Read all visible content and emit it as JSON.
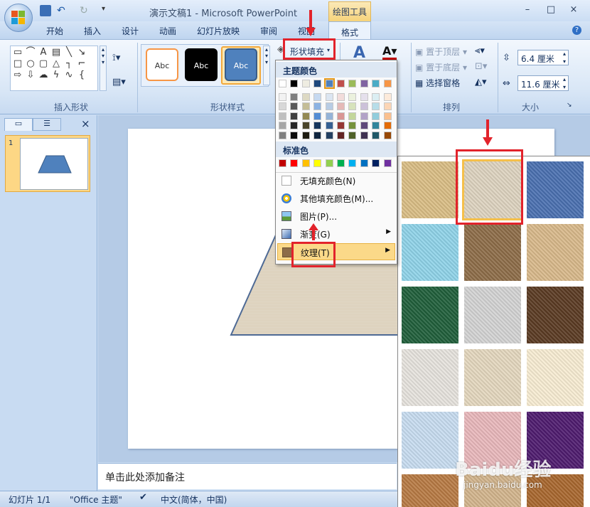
{
  "title_bar": {
    "title": "演示文稿1 - Microsoft PowerPoint",
    "context_tab": "绘图工具",
    "minimize": "–",
    "restore": "□",
    "close": "×"
  },
  "tabs": [
    "开始",
    "插入",
    "设计",
    "动画",
    "幻灯片放映",
    "审阅",
    "视图",
    "格式"
  ],
  "ribbon": {
    "groups": {
      "insert_shapes": "插入形状",
      "shape_styles": "形状样式",
      "arrange": "排列",
      "size": "大小"
    },
    "style_samples": [
      "Abc",
      "Abc",
      "Abc"
    ],
    "shape_fill": "形状填充",
    "arrange": {
      "bring_front": "置于顶层",
      "send_back": "置于底层",
      "selection_pane": "选择窗格"
    },
    "size": {
      "height": "6.4 厘米",
      "width": "11.6 厘米"
    }
  },
  "slide_panel": {
    "slide_number": "1"
  },
  "notes": {
    "placeholder": "单击此处添加备注"
  },
  "fill_menu": {
    "theme_colors_header": "主题颜色",
    "theme_top": [
      "#ffffff",
      "#000000",
      "#eeece1",
      "#1f497d",
      "#4f81bd",
      "#c0504d",
      "#9bbb59",
      "#8064a2",
      "#4bacc6",
      "#f79646"
    ],
    "theme_shades": [
      [
        "#f2f2f2",
        "#7f7f7f",
        "#ddd9c3",
        "#c6d9f0",
        "#dbe5f1",
        "#f2dcdb",
        "#ebf1dd",
        "#e5e0ec",
        "#dbeef3",
        "#fdeada"
      ],
      [
        "#d8d8d8",
        "#595959",
        "#c4bd97",
        "#8db3e2",
        "#b8cce4",
        "#e5b9b7",
        "#d7e3bc",
        "#ccc1d9",
        "#b7dde8",
        "#fbd5b5"
      ],
      [
        "#bfbfbf",
        "#3f3f3f",
        "#938953",
        "#548dd4",
        "#95b3d7",
        "#d99694",
        "#c3d69b",
        "#b2a2c7",
        "#92cddc",
        "#fac08f"
      ],
      [
        "#a5a5a5",
        "#262626",
        "#494429",
        "#17365d",
        "#366092",
        "#953734",
        "#76923c",
        "#5f497a",
        "#31859b",
        "#e36c09"
      ],
      [
        "#7f7f7f",
        "#0c0c0c",
        "#1d1b10",
        "#0f243e",
        "#244061",
        "#632423",
        "#4f6128",
        "#3f3151",
        "#205867",
        "#974806"
      ]
    ],
    "standard_header": "标准色",
    "standard_colors": [
      "#c00000",
      "#ff0000",
      "#ffc000",
      "#ffff00",
      "#92d050",
      "#00b050",
      "#00b0f0",
      "#0070c0",
      "#002060",
      "#7030a0"
    ],
    "items": {
      "no_fill": "无填充颜色(N)",
      "more_colors": "其他填充颜色(M)...",
      "picture": "图片(P)...",
      "gradient": "渐变(G)",
      "texture": "纹理(T)"
    }
  },
  "textures": [
    "#d9bd84",
    "#ddd3bf",
    "#4a70b0",
    "#8fd3e8",
    "#8d6c48",
    "#d8b88a",
    "#1f5e3a",
    "#d3d3d3",
    "#5a3a22",
    "#e6e3dd",
    "#e4d7be",
    "#f7ecd2",
    "#c7dcf0",
    "#e8b7bb",
    "#4e1b6e",
    "#b77a43",
    "#d2b48c",
    "#a8672e"
  ],
  "status_bar": {
    "slide_info": "幻灯片 1/1",
    "theme": "\"Office 主题\"",
    "language": "中文(简体，中国)"
  },
  "watermark": {
    "brand": "Baidu经验",
    "url": "jingyan.baidu.com"
  },
  "colors": {
    "highlight": "#e2232b",
    "selected_tab": "#f6d37a",
    "menu_hover": "#fbd989"
  }
}
